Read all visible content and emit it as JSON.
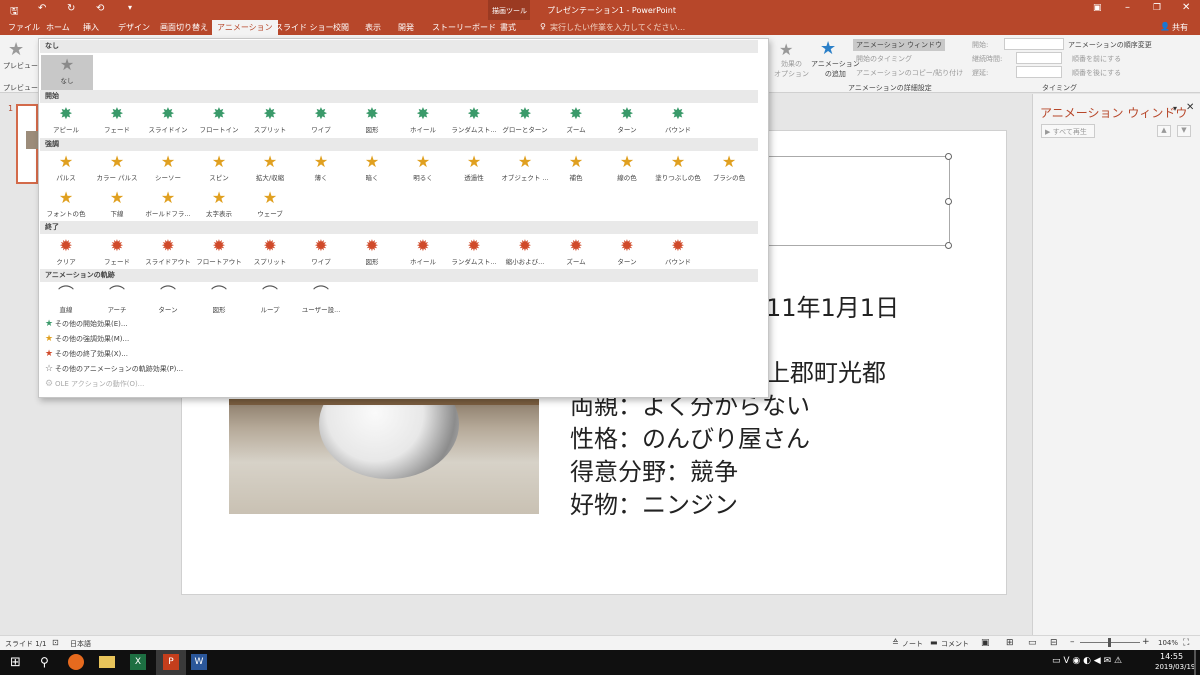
{
  "title": {
    "doc": "プレゼンテーション1 - PowerPoint",
    "ctx_tool": "描画ツール",
    "qat": [
      "↶",
      "↻",
      "⟲",
      "▾"
    ]
  },
  "tabs": [
    "ファイル",
    "ホーム",
    "挿入",
    "デザイン",
    "画面切り替え",
    "アニメーション",
    "スライド ショー",
    "校閲",
    "表示",
    "開発",
    "ストーリーボード",
    "書式"
  ],
  "active_tab": "アニメーション",
  "tell_me": "実行したい作業を入力してください...",
  "share": "共有",
  "ribbon": {
    "preview": "プレビュー",
    "preview_group": "プレビュー",
    "effect_options": "効果の\nオプション",
    "add_animation": "アニメーション\nの追加",
    "anim_pane_btn": "アニメーション ウィンドウ",
    "start_timing": "開始のタイミング",
    "copy_paste": "アニメーションのコピー/貼り付け",
    "detail_group": "アニメーションの詳細設定",
    "start": "開始:",
    "duration": "継続時間:",
    "delay": "遅延:",
    "reorder": "アニメーションの順序変更",
    "move_earlier": "順番を前にする",
    "move_later": "順番を後にする",
    "timing_group": "タイミング"
  },
  "gallery": {
    "none_header": "なし",
    "none_item": "なし",
    "entrance_header": "開始",
    "entrance": [
      "アピール",
      "フェード",
      "スライドイン",
      "フロートイン",
      "スプリット",
      "ワイプ",
      "図形",
      "ホイール",
      "ランダムスト...",
      "グローとターン",
      "ズーム",
      "ターン",
      "バウンド"
    ],
    "emphasis_header": "強調",
    "emphasis": [
      "パルス",
      "カラー パルス",
      "シーソー",
      "スピン",
      "拡大/収縮",
      "薄く",
      "暗く",
      "明るく",
      "透過性",
      "オブジェクト ...",
      "補色",
      "線の色",
      "塗りつぶしの色",
      "ブラシの色",
      "フォントの色",
      "下線",
      "ボールドフラ...",
      "太字表示",
      "ウェーブ"
    ],
    "exit_header": "終了",
    "exit": [
      "クリア",
      "フェード",
      "スライドアウト",
      "フロートアウト",
      "スプリット",
      "ワイプ",
      "図形",
      "ホイール",
      "ランダムスト...",
      "縮小および...",
      "ズーム",
      "ターン",
      "バウンド"
    ],
    "path_header": "アニメーションの軌跡",
    "paths": [
      "直線",
      "アーチ",
      "ターン",
      "図形",
      "ループ",
      "ユーザー設..."
    ],
    "more": [
      "その他の開始効果(E)...",
      "その他の強調効果(M)...",
      "その他の終了効果(X)...",
      "その他のアニメーションの軌跡効果(P)...",
      "OLE アクションの動作(O)..."
    ]
  },
  "slide": {
    "lines": [
      "11年1月1日",
      "上郡町光都",
      "両親：よく分からない",
      "性格：のんびり屋さん",
      "得意分野：競争",
      "好物：ニンジン"
    ]
  },
  "pane": {
    "title": "アニメーション ウィンドウ",
    "play": "すべて再生"
  },
  "status": {
    "slide": "スライド 1/1",
    "lang": "日本語",
    "notes": "ノート",
    "comments": "コメント",
    "zoom": "104%"
  },
  "taskbar": {
    "time": "14:55",
    "date": "2019/03/19"
  },
  "colors": {
    "accent": "#b7472a",
    "entrance": "#3a9a6a",
    "emphasis": "#e0a020",
    "exit": "#d04a2a"
  }
}
